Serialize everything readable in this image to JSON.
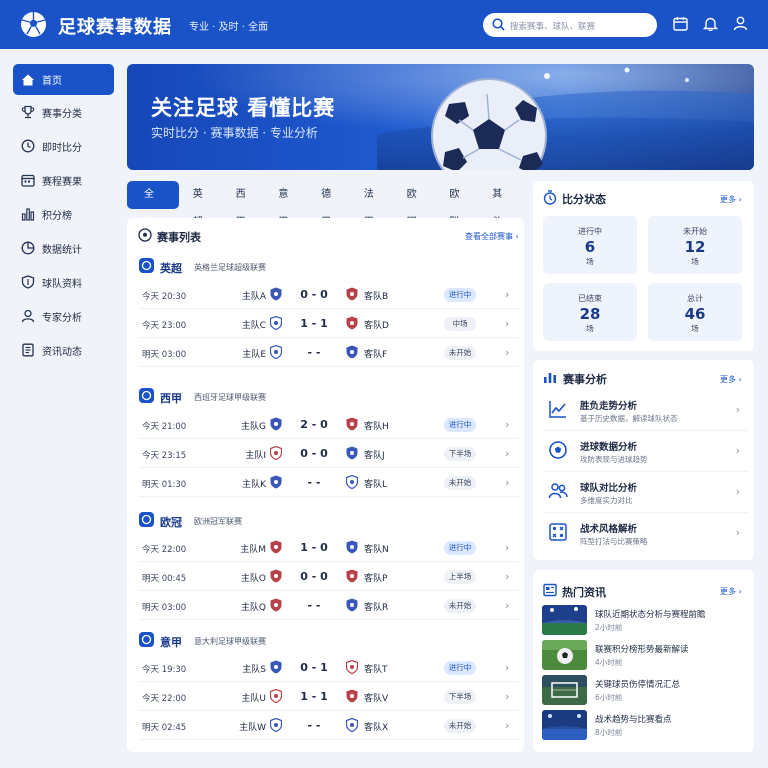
{
  "app": {
    "title": "足球赛事数据",
    "slogan": "专业 · 及时 · 全面"
  },
  "search": {
    "placeholder": "搜索赛事、球队、联赛"
  },
  "sidebar": {
    "items": [
      {
        "label": "首页",
        "icon": "home-icon",
        "active": true
      },
      {
        "label": "赛事分类",
        "icon": "trophy-icon"
      },
      {
        "label": "即时比分",
        "icon": "clock-icon"
      },
      {
        "label": "赛程赛果",
        "icon": "calendar-icon"
      },
      {
        "label": "积分榜",
        "icon": "bar-chart-icon"
      },
      {
        "label": "数据统计",
        "icon": "pie-chart-icon"
      },
      {
        "label": "球队资料",
        "icon": "shield-icon"
      },
      {
        "label": "专家分析",
        "icon": "user-icon"
      },
      {
        "label": "资讯动态",
        "icon": "document-icon"
      }
    ]
  },
  "hero": {
    "title": "关注足球  看懂比赛",
    "subtitle": "实时比分 · 赛事数据 · 专业分析"
  },
  "tabs": [
    "全部",
    "英超",
    "西甲",
    "意甲",
    "德甲",
    "法甲",
    "欧冠",
    "欧联",
    "其他"
  ],
  "match_list": {
    "title": "赛事列表",
    "more": "查看全部赛事 ›",
    "leagues": [
      {
        "name": "英超",
        "full": "英格兰足球超级联赛",
        "matches": [
          {
            "time": "今天 20:30",
            "home": "主队A",
            "score": "0 - 0",
            "away": "客队B",
            "status": "进行中",
            "live": true
          },
          {
            "time": "今天 23:00",
            "home": "主队C",
            "score": "1 - 1",
            "away": "客队D",
            "status": "中场",
            "live": false
          },
          {
            "time": "明天 03:00",
            "home": "主队E",
            "score": "- -",
            "away": "客队F",
            "status": "未开始",
            "live": false
          }
        ]
      },
      {
        "name": "西甲",
        "full": "西班牙足球甲级联赛",
        "matches": [
          {
            "time": "今天 21:00",
            "home": "主队G",
            "score": "2 - 0",
            "away": "客队H",
            "status": "进行中",
            "live": true
          },
          {
            "time": "今天 23:15",
            "home": "主队I",
            "score": "0 - 0",
            "away": "客队J",
            "status": "下半场",
            "live": false
          },
          {
            "time": "明天 01:30",
            "home": "主队K",
            "score": "- -",
            "away": "客队L",
            "status": "未开始",
            "live": false
          }
        ]
      },
      {
        "name": "欧冠",
        "full": "欧洲冠军联赛",
        "matches": [
          {
            "time": "今天 22:00",
            "home": "主队M",
            "score": "1 - 0",
            "away": "客队N",
            "status": "进行中",
            "live": true
          },
          {
            "time": "明天 00:45",
            "home": "主队O",
            "score": "0 - 0",
            "away": "客队P",
            "status": "上半场",
            "live": false
          },
          {
            "time": "明天 03:00",
            "home": "主队Q",
            "score": "- -",
            "away": "客队R",
            "status": "未开始",
            "live": false
          }
        ]
      },
      {
        "name": "意甲",
        "full": "意大利足球甲级联赛",
        "matches": [
          {
            "time": "今天 19:30",
            "home": "主队S",
            "score": "0 - 1",
            "away": "客队T",
            "status": "进行中",
            "live": true
          },
          {
            "time": "今天 22:00",
            "home": "主队U",
            "score": "1 - 1",
            "away": "客队V",
            "status": "下半场",
            "live": false
          },
          {
            "time": "明天 02:45",
            "home": "主队W",
            "score": "- -",
            "away": "客队X",
            "status": "未开始",
            "live": false
          }
        ]
      }
    ]
  },
  "score_status": {
    "title": "比分状态",
    "more": "更多 ›",
    "stats": [
      {
        "label": "进行中",
        "value": "6",
        "unit": "场"
      },
      {
        "label": "未开始",
        "value": "12",
        "unit": "场"
      },
      {
        "label": "已结束",
        "value": "28",
        "unit": "场"
      },
      {
        "label": "总计",
        "value": "46",
        "unit": "场"
      }
    ]
  },
  "analysis": {
    "title": "赛事分析",
    "more": "更多 ›",
    "items": [
      {
        "name": "胜负走势分析",
        "desc": "基于历史数据，解读球队状态",
        "icon": "trend-line-icon"
      },
      {
        "name": "进球数据分析",
        "desc": "攻防表现与进球趋势",
        "icon": "soccer-ball-icon"
      },
      {
        "name": "球队对比分析",
        "desc": "多维度实力对比",
        "icon": "team-compare-icon"
      },
      {
        "name": "战术风格解析",
        "desc": "阵型打法与比赛策略",
        "icon": "tactics-board-icon"
      }
    ]
  },
  "news": {
    "title": "热门资讯",
    "more": "更多 ›",
    "items": [
      {
        "title": "球队近期状态分析与赛程前瞻",
        "time": "2小时前"
      },
      {
        "title": "联赛积分榜形势最新解读",
        "time": "4小时前"
      },
      {
        "title": "关键球员伤停情况汇总",
        "time": "6小时前"
      },
      {
        "title": "战术趋势与比赛看点",
        "time": "8小时前"
      }
    ]
  },
  "colors": {
    "primary": "#1a53c7",
    "background": "#f0f4fa",
    "live_badge": "#dbe8ff",
    "home_shield": "#3a56b8",
    "away_shield": "#b8424a"
  }
}
